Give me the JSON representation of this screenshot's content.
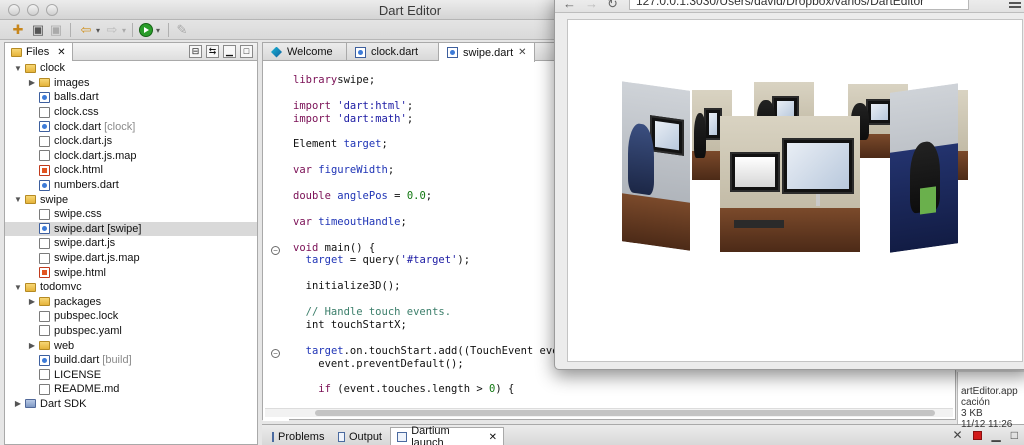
{
  "window": {
    "title": "Dart Editor"
  },
  "files_panel": {
    "tab_label": "Files",
    "items": [
      {
        "label": "clock",
        "tag": "",
        "type": "folder",
        "depth": 0,
        "expanded": true
      },
      {
        "label": "images",
        "tag": "",
        "type": "folder",
        "depth": 1,
        "expanded": false
      },
      {
        "label": "balls.dart",
        "tag": "",
        "type": "dart",
        "depth": 1
      },
      {
        "label": "clock.css",
        "tag": "",
        "type": "file",
        "depth": 1
      },
      {
        "label": "clock.dart",
        "tag": "[clock]",
        "type": "dart",
        "depth": 1
      },
      {
        "label": "clock.dart.js",
        "tag": "",
        "type": "file",
        "depth": 1
      },
      {
        "label": "clock.dart.js.map",
        "tag": "",
        "type": "file",
        "depth": 1
      },
      {
        "label": "clock.html",
        "tag": "",
        "type": "html",
        "depth": 1
      },
      {
        "label": "numbers.dart",
        "tag": "",
        "type": "dart",
        "depth": 1
      },
      {
        "label": "swipe",
        "tag": "",
        "type": "folder",
        "depth": 0,
        "expanded": true
      },
      {
        "label": "swipe.css",
        "tag": "",
        "type": "file",
        "depth": 1
      },
      {
        "label": "swipe.dart [swipe]",
        "tag": "",
        "type": "dart",
        "depth": 1,
        "selected": true
      },
      {
        "label": "swipe.dart.js",
        "tag": "",
        "type": "file",
        "depth": 1
      },
      {
        "label": "swipe.dart.js.map",
        "tag": "",
        "type": "file",
        "depth": 1
      },
      {
        "label": "swipe.html",
        "tag": "",
        "type": "html",
        "depth": 1
      },
      {
        "label": "todomvc",
        "tag": "",
        "type": "folder",
        "depth": 0,
        "expanded": true
      },
      {
        "label": "packages",
        "tag": "",
        "type": "folder",
        "depth": 1,
        "expanded": false
      },
      {
        "label": "pubspec.lock",
        "tag": "",
        "type": "file",
        "depth": 1
      },
      {
        "label": "pubspec.yaml",
        "tag": "",
        "type": "file",
        "depth": 1
      },
      {
        "label": "web",
        "tag": "",
        "type": "folder",
        "depth": 1,
        "expanded": false
      },
      {
        "label": "build.dart",
        "tag": "[build]",
        "type": "dart",
        "depth": 1
      },
      {
        "label": "LICENSE",
        "tag": "",
        "type": "file",
        "depth": 1
      },
      {
        "label": "README.md",
        "tag": "",
        "type": "file",
        "depth": 1
      },
      {
        "label": "Dart SDK",
        "tag": "",
        "type": "sdk",
        "depth": 0,
        "expanded": false
      }
    ]
  },
  "editor_tabs": [
    {
      "label": "Welcome",
      "icon": "welcome-icon"
    },
    {
      "label": "clock.dart",
      "icon": "dart-file-icon"
    },
    {
      "label": "swipe.dart",
      "icon": "dart-file-icon",
      "active": true
    }
  ],
  "code_lines": [
    [
      [
        "kw",
        "library"
      ],
      [
        "",
        "swipe;"
      ]
    ],
    [],
    [
      [
        "kw",
        "import"
      ],
      [
        "",
        ""
      ],
      [
        "str",
        "'dart:html'"
      ],
      [
        "",
        ";"
      ]
    ],
    [
      [
        "kw",
        "import"
      ],
      [
        "",
        ""
      ],
      [
        "str",
        "'dart:math'"
      ],
      [
        "",
        ";"
      ]
    ],
    [],
    [
      [
        "",
        "Element "
      ],
      [
        "fld",
        "target"
      ],
      [
        "",
        ";"
      ]
    ],
    [],
    [
      [
        "kw",
        "var"
      ],
      [
        "",
        ""
      ],
      [
        "fld",
        "figureWidth"
      ],
      [
        "",
        ";"
      ]
    ],
    [],
    [
      [
        "kw",
        "double"
      ],
      [
        "",
        ""
      ],
      [
        "fld",
        "anglePos"
      ],
      [
        "",
        " = "
      ],
      [
        "num",
        "0.0"
      ],
      [
        "",
        ";"
      ]
    ],
    [],
    [
      [
        "kw",
        "var"
      ],
      [
        "",
        ""
      ],
      [
        "fld",
        "timeoutHandle"
      ],
      [
        "",
        ";"
      ]
    ],
    [],
    [
      [
        "kw",
        "void"
      ],
      [
        "",
        " main() {"
      ]
    ],
    [
      [
        "",
        "  "
      ],
      [
        "fld",
        "target"
      ],
      [
        "",
        " = query("
      ],
      [
        "str",
        "'#target'"
      ],
      [
        "",
        ");"
      ]
    ],
    [],
    [
      [
        "",
        "  initialize3D();"
      ]
    ],
    [],
    [
      [
        "cmt",
        "  // Handle touch events."
      ]
    ],
    [
      [
        "",
        "  int touchStartX;"
      ]
    ],
    [],
    [
      [
        "",
        "  "
      ],
      [
        "fld",
        "target"
      ],
      [
        "",
        ".on.touchStart.add((TouchEvent event) {"
      ]
    ],
    [
      [
        "",
        "    event.preventDefault();"
      ]
    ],
    [],
    [
      [
        "",
        "    "
      ],
      [
        "kw",
        "if"
      ],
      [
        "",
        " (event.touches.length > "
      ],
      [
        "num",
        "0"
      ],
      [
        "",
        ") {"
      ]
    ]
  ],
  "bottom_tabs": [
    {
      "label": "Problems"
    },
    {
      "label": "Output"
    },
    {
      "label": "Dartium launch",
      "active": true
    }
  ],
  "browser": {
    "url": "127.0.0.1:3030/Users/david/Dropbox/varios/DartEditor"
  },
  "right_panel": {
    "lines": [
      "artEditor.app",
      "cación",
      "3 KB",
      "11/12 11:26"
    ]
  }
}
